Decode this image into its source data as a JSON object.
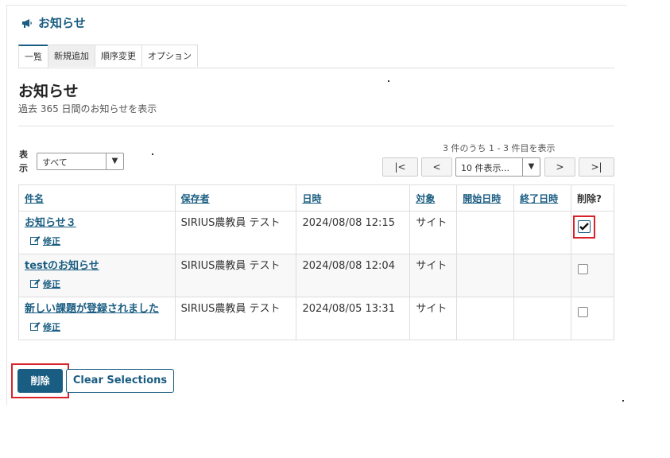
{
  "header": {
    "title": "お知らせ",
    "icon": "megaphone-icon"
  },
  "tabs": [
    {
      "label": "一覧",
      "active": true
    },
    {
      "label": "新規追加",
      "active": false
    },
    {
      "label": "順序変更",
      "active": false
    },
    {
      "label": "オプション",
      "active": false
    }
  ],
  "page": {
    "title": "お知らせ",
    "subtitle": "過去 365 日間のお知らせを表示"
  },
  "filter": {
    "label": "表示",
    "selected": "すべて"
  },
  "pager": {
    "info": "3 件のうち 1 - 3 件目を表示",
    "first": "|<",
    "prev": "<",
    "page_size": "10 件表示...",
    "next": ">",
    "last": ">|"
  },
  "table": {
    "headers": {
      "subject": "件名",
      "saver": "保存者",
      "date": "日時",
      "target": "対象",
      "start": "開始日時",
      "end": "終了日時",
      "delete": "削除?"
    },
    "edit_label": "修正",
    "rows": [
      {
        "subject": "お知らせ３",
        "saver": "SIRIUS農教員 テスト",
        "date": "2024/08/08 12:15",
        "target": "サイト",
        "start": "",
        "end": "",
        "checked": true
      },
      {
        "subject": "testのお知らせ",
        "saver": "SIRIUS農教員 テスト",
        "date": "2024/08/08 12:04",
        "target": "サイト",
        "start": "",
        "end": "",
        "checked": false
      },
      {
        "subject": "新しい課題が登録されました",
        "saver": "SIRIUS農教員 テスト",
        "date": "2024/08/05 13:31",
        "target": "サイト",
        "start": "",
        "end": "",
        "checked": false
      }
    ]
  },
  "actions": {
    "delete_label": "削除",
    "clear_label": "Clear Selections"
  },
  "colors": {
    "accent": "#1a5d82",
    "highlight": "#d9222a"
  }
}
